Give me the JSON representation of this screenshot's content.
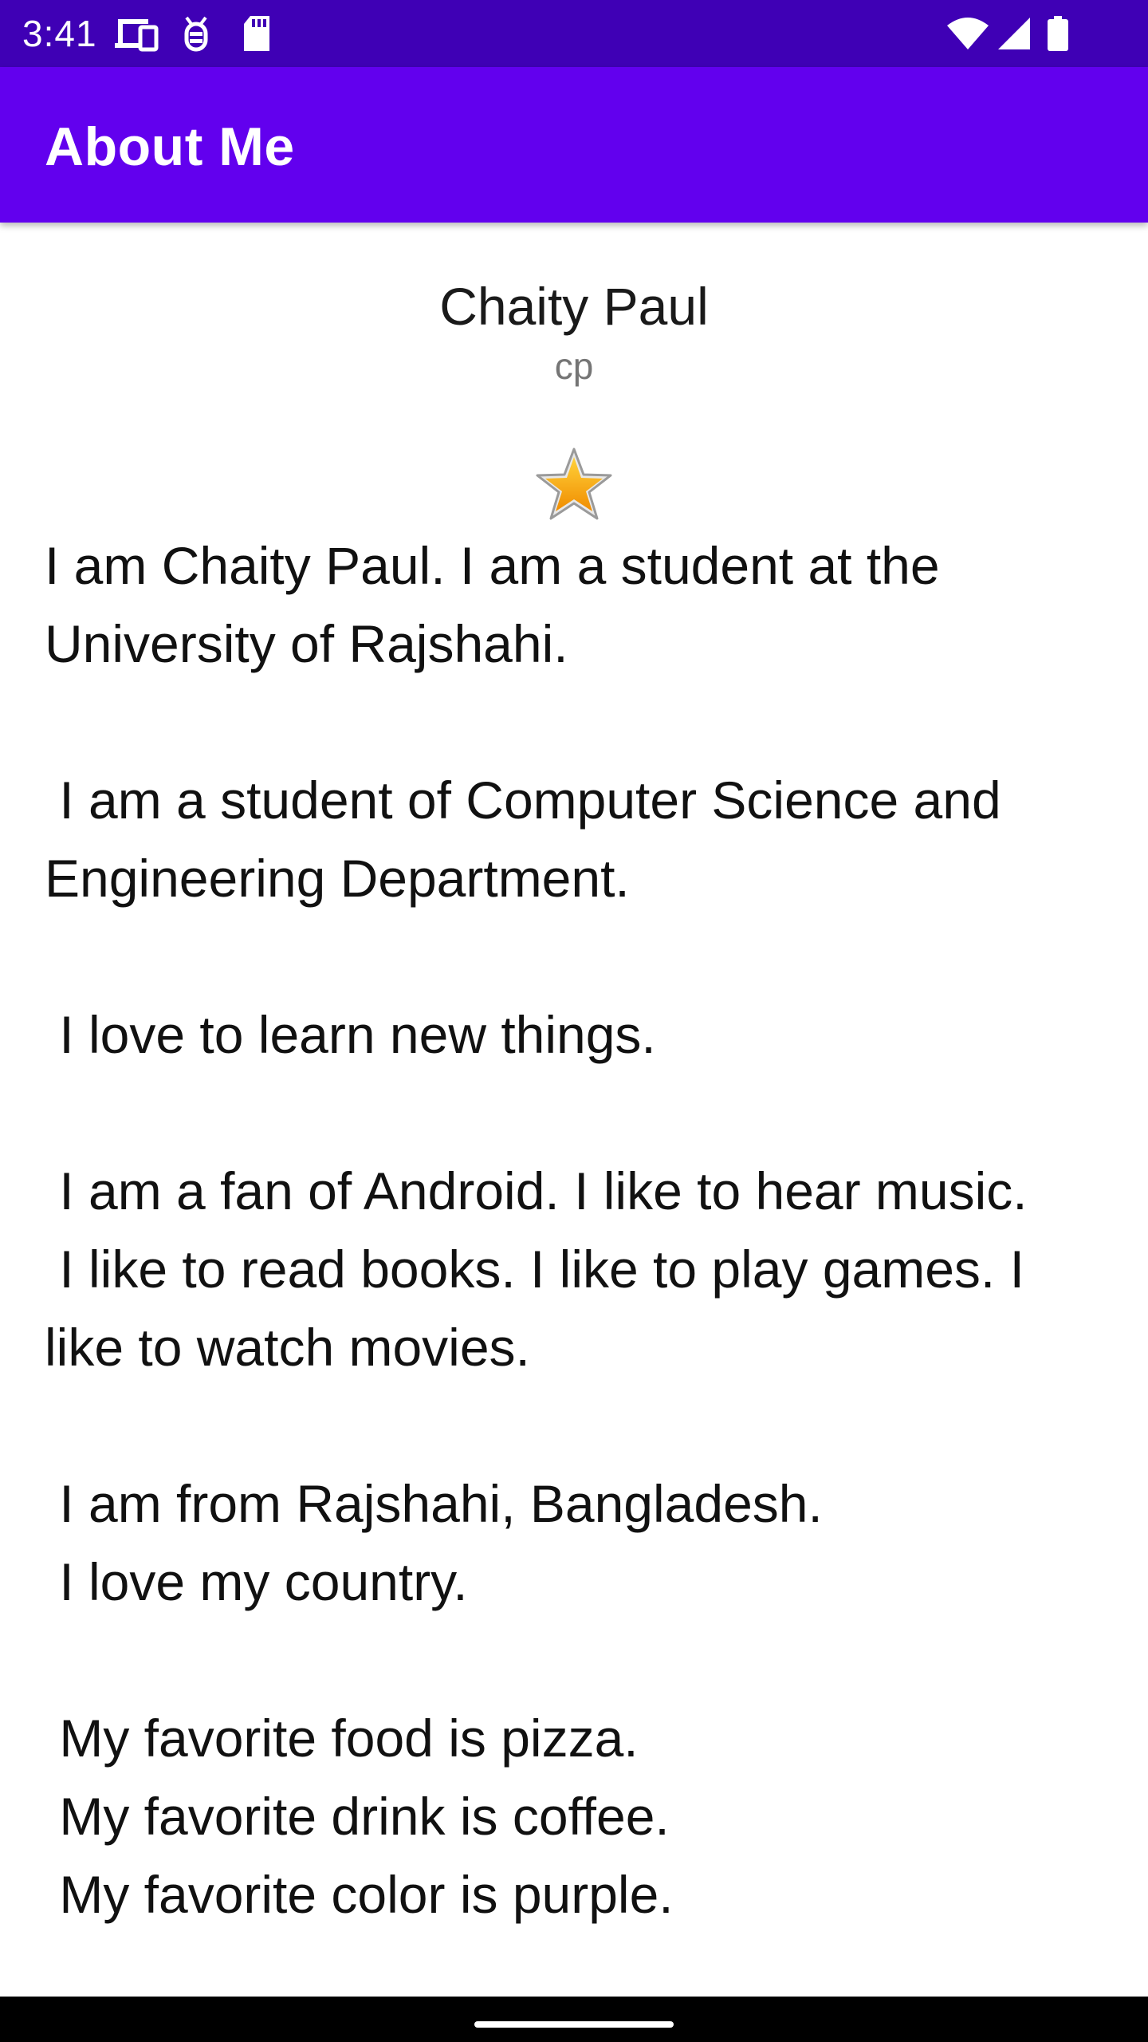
{
  "status_bar": {
    "time": "3:41",
    "left_icons": [
      "cast-icon",
      "debug-icon",
      "sd-card-icon"
    ],
    "right_icons": [
      "wifi-icon",
      "signal-icon",
      "battery-icon"
    ],
    "background_color": "#3f00b5"
  },
  "app_bar": {
    "title": "About Me",
    "background_color": "#6200ee"
  },
  "profile": {
    "name": "Chaity Paul",
    "nickname": "cp",
    "icon": "star-icon"
  },
  "bio": {
    "text": "I am Chaity Paul. I am a student at the University of Rajshahi.\n\n I am a student of Computer Science and Engineering Department.\n\n I love to learn new things.\n\n I am a fan of Android. I like to hear music.\n I like to read books. I like to play games. I like to watch movies.\n\n I am from Rajshahi, Bangladesh.\n I love my country.\n\n My favorite food is pizza.\n My favorite drink is coffee.\n My favorite color is purple."
  },
  "nav_bar": {
    "handle": "home-gesture-handle"
  }
}
